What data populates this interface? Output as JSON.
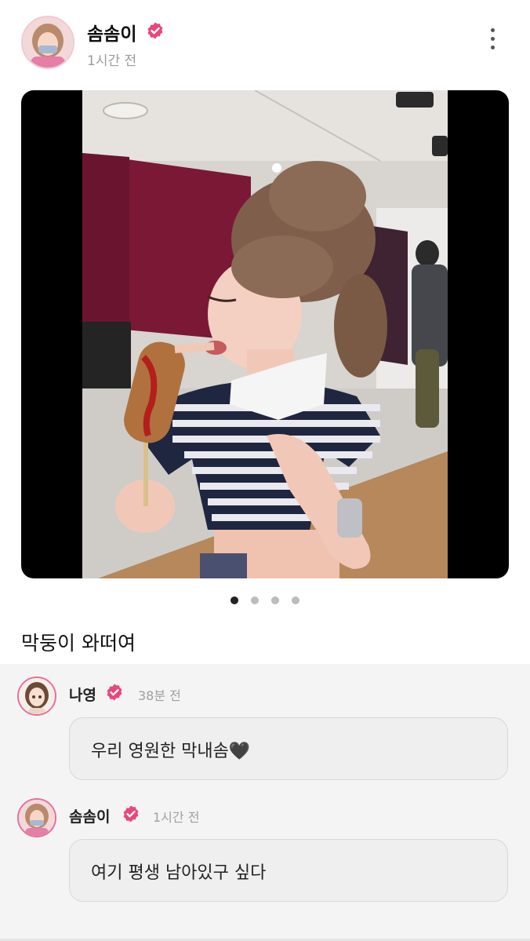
{
  "post": {
    "author": "솜솜이",
    "time": "1시간 전",
    "caption": "막둥이 와떠여",
    "carousel_pages": 4,
    "carousel_active": 1
  },
  "comments": [
    {
      "author": "나영",
      "time": "38분 전",
      "text": "우리 영원한 막내솜🖤"
    },
    {
      "author": "솜솜이",
      "time": "1시간 전",
      "text": "여기 평생 남아있구 싶다"
    }
  ],
  "colors": {
    "verified": "#e8467c",
    "avatar_ring": "#e76f96"
  }
}
